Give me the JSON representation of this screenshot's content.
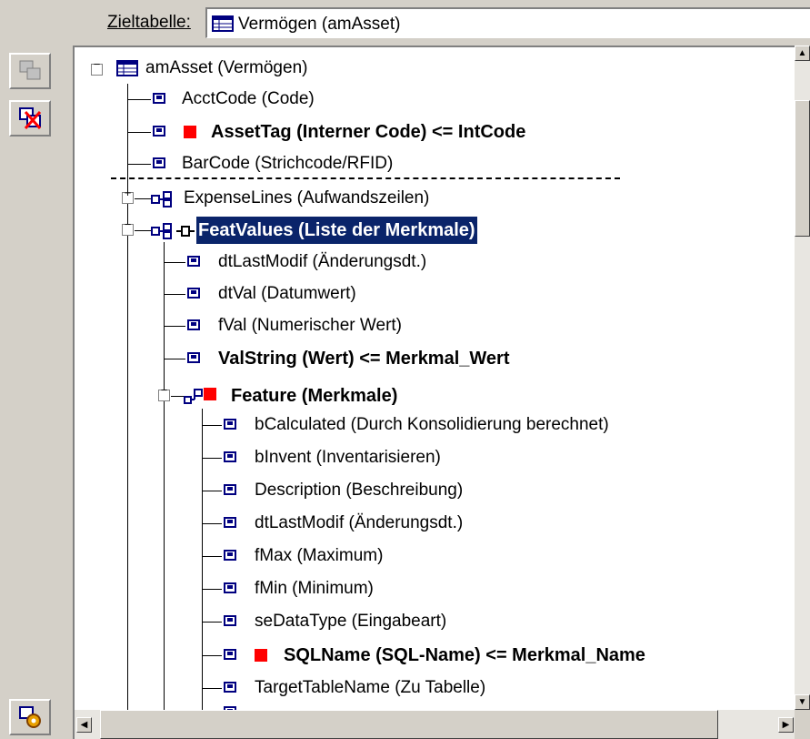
{
  "header": {
    "target_label": "Zieltabelle:",
    "target_value": "Vermögen (amAsset)"
  },
  "toolbar": {
    "icons": [
      "copy-table-icon",
      "delete-mapping-icon",
      "settings-icon"
    ]
  },
  "tree": {
    "root": "amAsset (Vermögen)",
    "nodes": [
      {
        "label": "AcctCode (Code)"
      },
      {
        "label": "AssetTag (Interner Code)  <=  IntCode"
      },
      {
        "label": "BarCode (Strichcode/RFID)"
      },
      {
        "label": "ExpenseLines (Aufwandszeilen)"
      },
      {
        "label": "FeatValues (Liste der Merkmale)"
      },
      {
        "label": "dtLastModif (Änderungsdt.)"
      },
      {
        "label": "dtVal (Datumwert)"
      },
      {
        "label": "fVal (Numerischer Wert)"
      },
      {
        "label": "ValString (Wert)  <=  Merkmal_Wert"
      },
      {
        "label": "Feature (Merkmale)"
      },
      {
        "label": "bCalculated (Durch Konsolidierung berechnet)"
      },
      {
        "label": "bInvent (Inventarisieren)"
      },
      {
        "label": "Description (Beschreibung)"
      },
      {
        "label": "dtLastModif (Änderungsdt.)"
      },
      {
        "label": "fMax (Maximum)"
      },
      {
        "label": "fMin (Minimum)"
      },
      {
        "label": "seDataType (Eingabeart)"
      },
      {
        "label": "SQLName (SQL-Name)  <=  Merkmal_Name"
      },
      {
        "label": "TargetTableName (Zu Tabelle)"
      }
    ]
  },
  "colors": {
    "selection": "#0a246a",
    "mapped_marker": "#ff0000",
    "chrome": "#d4d0c8"
  }
}
